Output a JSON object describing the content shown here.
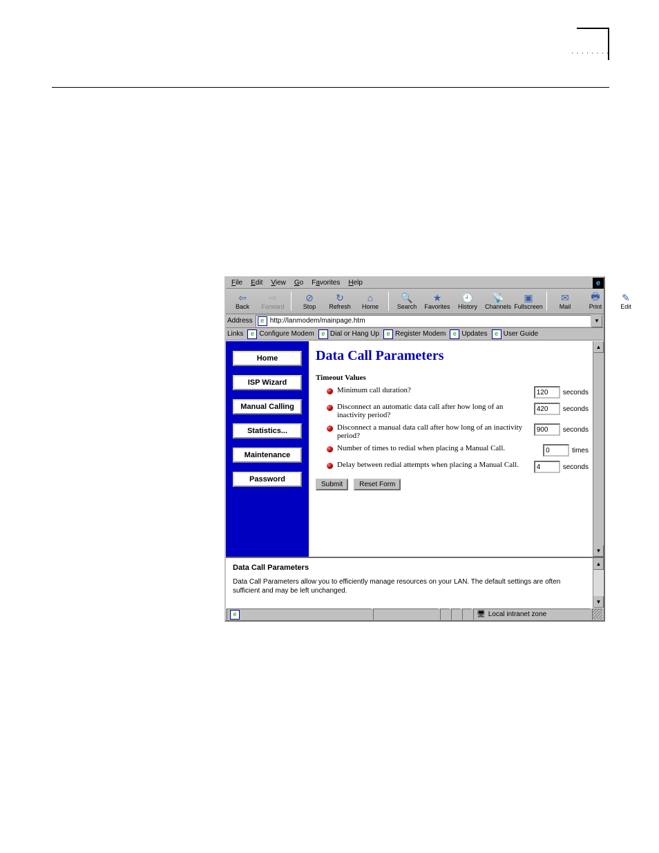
{
  "menubar": [
    "File",
    "Edit",
    "View",
    "Go",
    "Favorites",
    "Help"
  ],
  "toolbar": {
    "back": "Back",
    "forward": "Forward",
    "stop": "Stop",
    "refresh": "Refresh",
    "home": "Home",
    "search": "Search",
    "favorites": "Favorites",
    "history": "History",
    "channels": "Channels",
    "fullscreen": "Fullscreen",
    "mail": "Mail",
    "print": "Print",
    "edit": "Edit"
  },
  "address": {
    "label": "Address",
    "url": "http://lanmodem/mainpage.htm"
  },
  "linksbar": {
    "label": "Links",
    "items": [
      "Configure Modem",
      "Dial or Hang Up",
      "Register Modem",
      "Updates",
      "User Guide"
    ]
  },
  "sidebar": [
    "Home",
    "ISP Wizard",
    "Manual Calling",
    "Statistics...",
    "Maintenance",
    "Password"
  ],
  "page": {
    "title": "Data Call Parameters",
    "section": "Timeout Values",
    "items": [
      {
        "q": "Minimum call duration?",
        "val": "120",
        "unit": "seconds"
      },
      {
        "q": "Disconnect an automatic data call after how long of an inactivity period?",
        "val": "420",
        "unit": "seconds"
      },
      {
        "q": "Disconnect a manual data call after how long of an inactivity period?",
        "val": "900",
        "unit": "seconds"
      },
      {
        "q": "Number of times to redial when placing a Manual Call.",
        "val": "0",
        "unit": "times"
      },
      {
        "q": "Delay between redial attempts when placing a Manual Call.",
        "val": "4",
        "unit": "seconds"
      }
    ],
    "submit": "Submit",
    "reset": "Reset Form"
  },
  "help": {
    "title": "Data Call Parameters",
    "body": "Data Call Parameters allow you to efficiently manage resources on your LAN. The default settings are often sufficient and may be left unchanged."
  },
  "status": {
    "zone": "Local intranet zone"
  }
}
